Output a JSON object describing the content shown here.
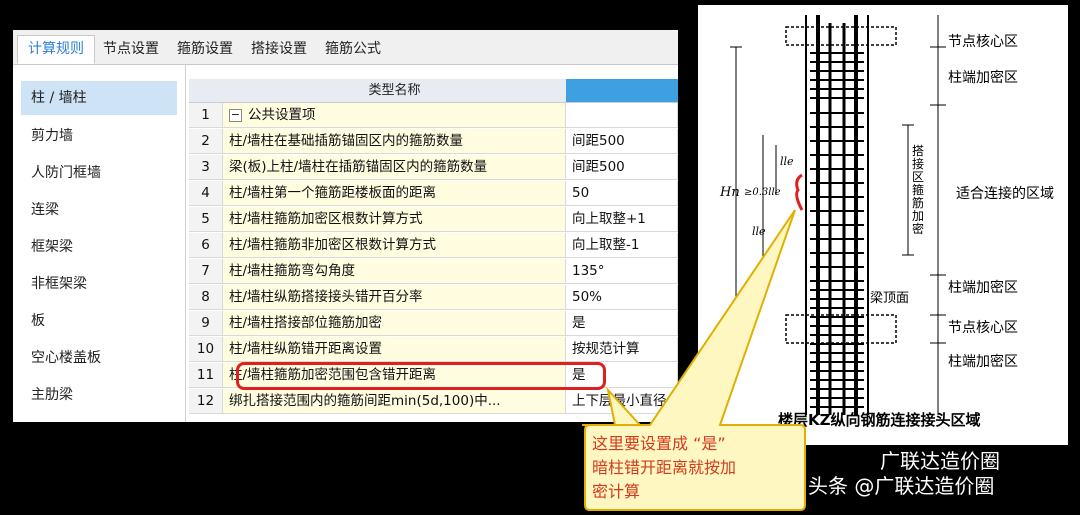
{
  "tabs": [
    "计算规则",
    "节点设置",
    "箍筋设置",
    "搭接设置",
    "箍筋公式"
  ],
  "sidebar": [
    "柱 / 墙柱",
    "剪力墙",
    "人防门框墙",
    "连梁",
    "框架梁",
    "非框架梁",
    "板",
    "空心楼盖板",
    "主肋梁"
  ],
  "grid": {
    "header_name": "类型名称",
    "header_value": "",
    "rows": [
      {
        "num": "1",
        "name": "公共设置项",
        "value": "",
        "group": true
      },
      {
        "num": "2",
        "name": "柱/墙柱在基础插筋锚固区内的箍筋数量",
        "value": "间距500"
      },
      {
        "num": "3",
        "name": "梁(板)上柱/墙柱在插筋锚固区内的箍筋数量",
        "value": "间距500"
      },
      {
        "num": "4",
        "name": "柱/墙柱第一个箍筋距楼板面的距离",
        "value": "50"
      },
      {
        "num": "5",
        "name": "柱/墙柱箍筋加密区根数计算方式",
        "value": "向上取整+1"
      },
      {
        "num": "6",
        "name": "柱/墙柱箍筋非加密区根数计算方式",
        "value": "向上取整-1"
      },
      {
        "num": "7",
        "name": "柱/墙柱箍筋弯勾角度",
        "value": "135°"
      },
      {
        "num": "8",
        "name": "柱/墙柱纵筋搭接接头错开百分率",
        "value": "50%"
      },
      {
        "num": "9",
        "name": "柱/墙柱搭接部位箍筋加密",
        "value": "是"
      },
      {
        "num": "10",
        "name": "柱/墙柱纵筋错开距离设置",
        "value": "按规范计算"
      },
      {
        "num": "11",
        "name": "柱/墙柱箍筋加密范围包含错开距离",
        "value": "是"
      },
      {
        "num": "12",
        "name": "绑扎搭接范围内的箍筋间距min(5d,100)中...",
        "value": "上下层最小直径"
      }
    ]
  },
  "diagram": {
    "labels_right": [
      "节点核心区",
      "柱端加密区",
      "适合连接的区域",
      "柱端加密区",
      "节点核心区",
      "柱端加密区"
    ],
    "beam_top": "梁顶面",
    "vertical_label": "搭接区箍筋加密",
    "hn": "Hn",
    "lle_top": "lle",
    "lle_bottom": "lle",
    "offset": "≥0.3lle",
    "caption": "楼层KZ纵向钢筋连接接头区域"
  },
  "callout": {
    "lines": [
      "这里要设置成 “是”",
      "暗柱错开距离就按加",
      "密计算"
    ]
  },
  "watermark": {
    "main": "头条 @广联达造价圈",
    "top": "广联达造价圈"
  },
  "colors": {
    "accent": "#2f7fd6",
    "highlight": "#e02020",
    "callout_fill": "#fff7c2",
    "callout_border": "#e0b000"
  }
}
